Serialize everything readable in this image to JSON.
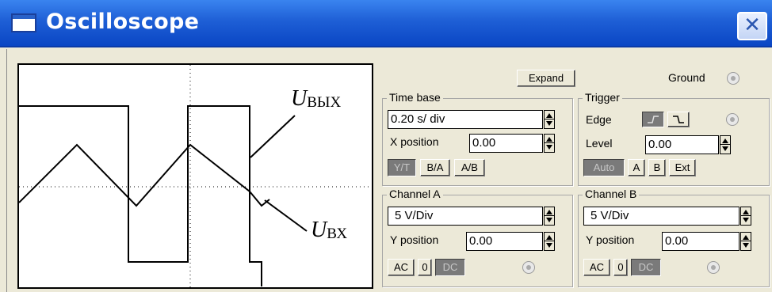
{
  "window": {
    "title": "Oscilloscope",
    "close_symbol": "✕"
  },
  "screen": {
    "annotation_out": {
      "letter": "U",
      "sub": "ВЫХ"
    },
    "annotation_in": {
      "letter": "U",
      "sub": "ВХ"
    }
  },
  "top": {
    "expand_label": "Expand",
    "ground_label": "Ground"
  },
  "time_base": {
    "label": "Time base",
    "value": "0.20 s/ div",
    "x_position_label": "X position",
    "x_position_value": "0.00",
    "modes": [
      "Y/T",
      "B/A",
      "A/B"
    ],
    "active_mode": "Y/T"
  },
  "trigger": {
    "label": "Trigger",
    "edge_label": "Edge",
    "level_label": "Level",
    "level_value": "0.00",
    "sources": [
      "Auto",
      "A",
      "B",
      "Ext"
    ],
    "active_source": "Auto"
  },
  "channel_a": {
    "label": "Channel A",
    "scale": "5 V/Div",
    "y_position_label": "Y position",
    "y_position_value": "0.00",
    "coupling": [
      "AC",
      "0",
      "DC"
    ],
    "active_coupling": "DC"
  },
  "channel_b": {
    "label": "Channel B",
    "scale": "5 V/Div",
    "y_position_label": "Y position",
    "y_position_value": "0.00",
    "coupling": [
      "AC",
      "0",
      "DC"
    ],
    "active_coupling": "DC"
  }
}
